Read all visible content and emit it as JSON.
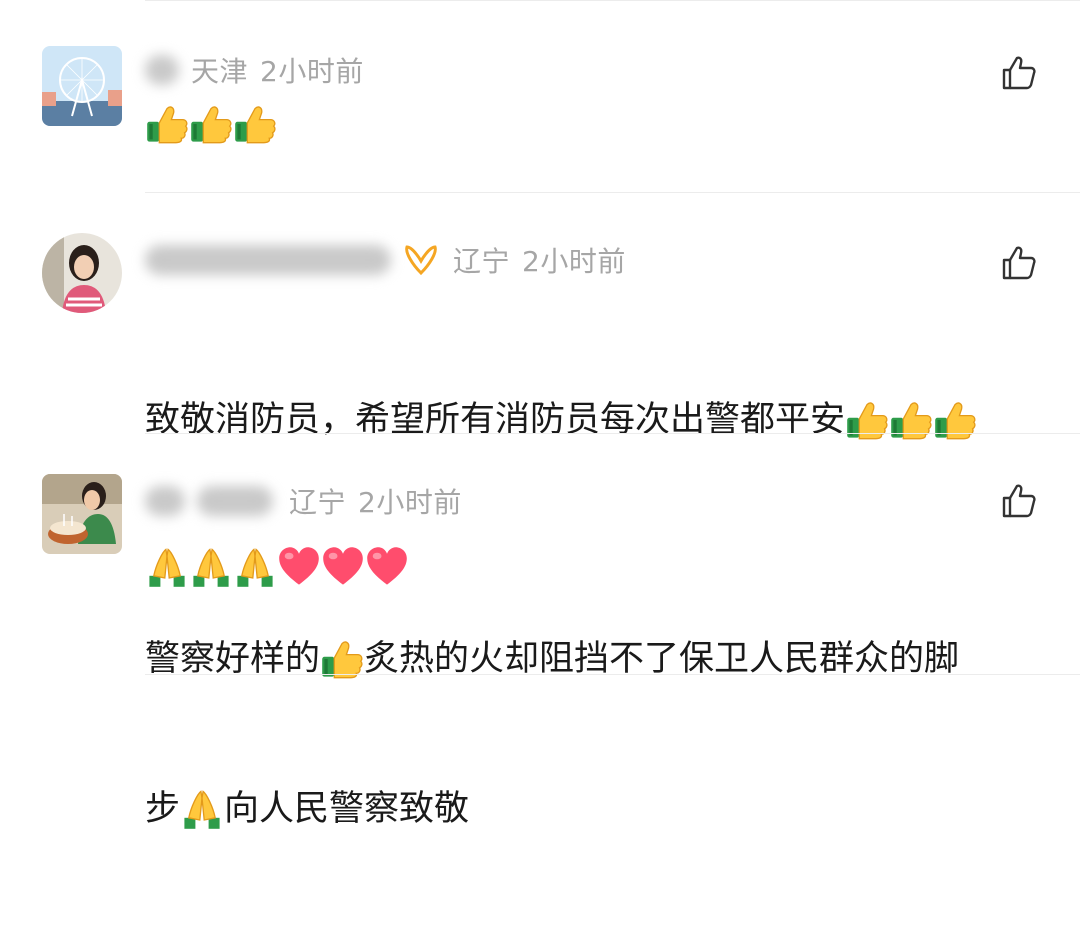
{
  "comments": [
    {
      "location": "天津",
      "time": "2小时前",
      "text": "",
      "avatar": "ferris-wheel-photo",
      "emojis_line1": [
        "thumbs-up",
        "thumbs-up",
        "thumbs-up"
      ]
    },
    {
      "location": "辽宁",
      "time": "2小时前",
      "text": "致敬消防员，希望所有消防员每次出警都平安",
      "avatar": "woman-portrait-photo",
      "badge": "orange-ribbon-badge",
      "emojis_after_text": [
        "thumbs-up",
        "thumbs-up",
        "thumbs-up"
      ],
      "emojis_line2": [
        "folded-hands",
        "folded-hands",
        "folded-hands",
        "heart",
        "heart",
        "heart"
      ]
    },
    {
      "location": "辽宁",
      "time": "2小时前",
      "text_part1": "警察好样的",
      "text_part2": "炙热的火却阻挡不了保卫人民群众的脚",
      "text_part3": "步",
      "text_part4": "向人民警察致敬",
      "avatar": "birthday-cake-photo"
    }
  ],
  "colors": {
    "meta": "#a6a6a6",
    "text": "#1a1a1a",
    "divider": "#ececec",
    "heart": "#ff4d6d",
    "badge": "#f5a623"
  }
}
